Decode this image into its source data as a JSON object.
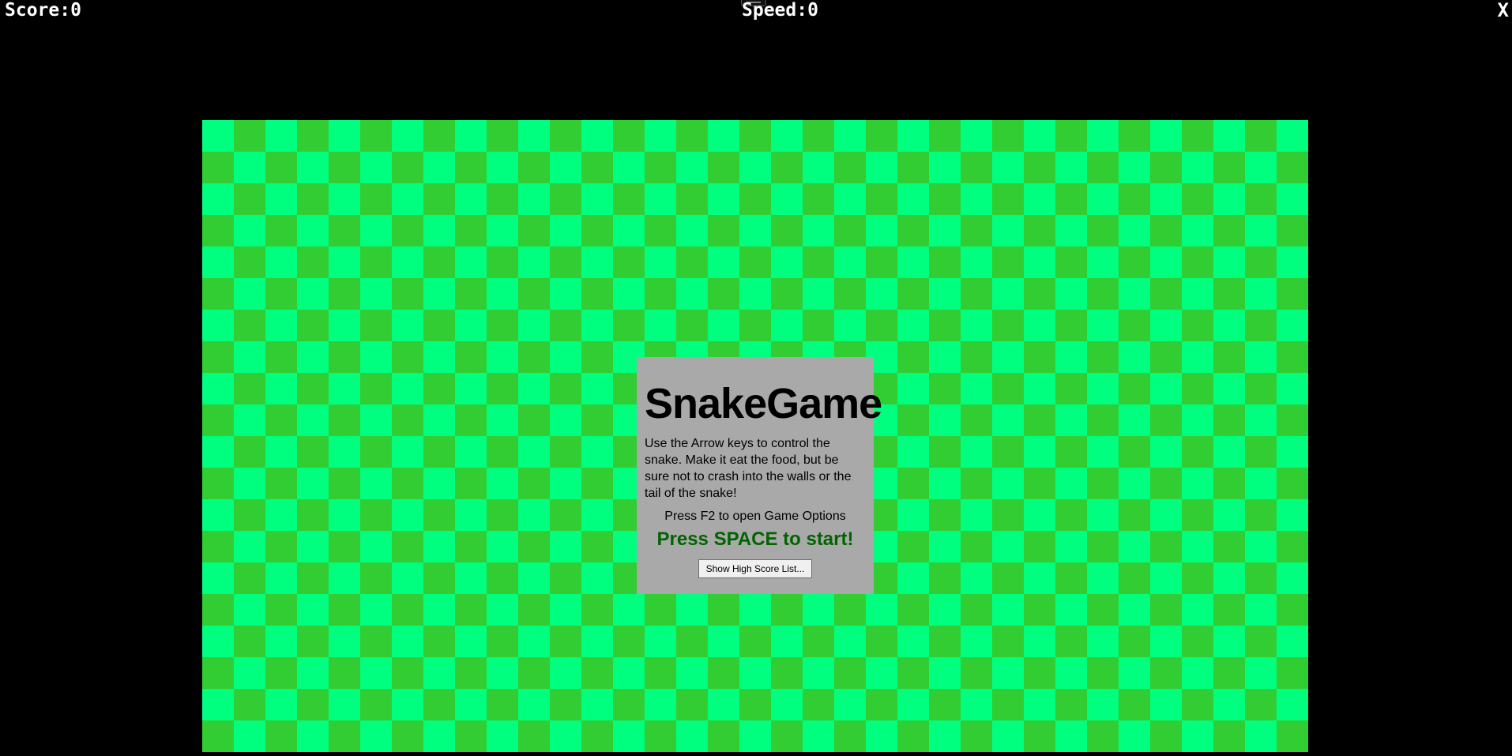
{
  "hud": {
    "score_label": "Score:0",
    "speed_label": "Speed:0",
    "close_label": "X"
  },
  "board": {
    "colors": {
      "light_square": "#00ff7f",
      "dark_square": "#32cd32",
      "background": "#000000"
    }
  },
  "dialog": {
    "title": "SnakeGame",
    "instructions": "Use the Arrow keys to control the snake. Make it eat the food, but be sure not to crash into the walls or the tail of the snake!",
    "options_hint": "Press F2 to open Game Options",
    "start_prompt": "Press SPACE to start!",
    "highscore_button_label": "Show High Score List...",
    "colors": {
      "panel": "#a9a9a9",
      "start_prompt": "#006400"
    }
  }
}
